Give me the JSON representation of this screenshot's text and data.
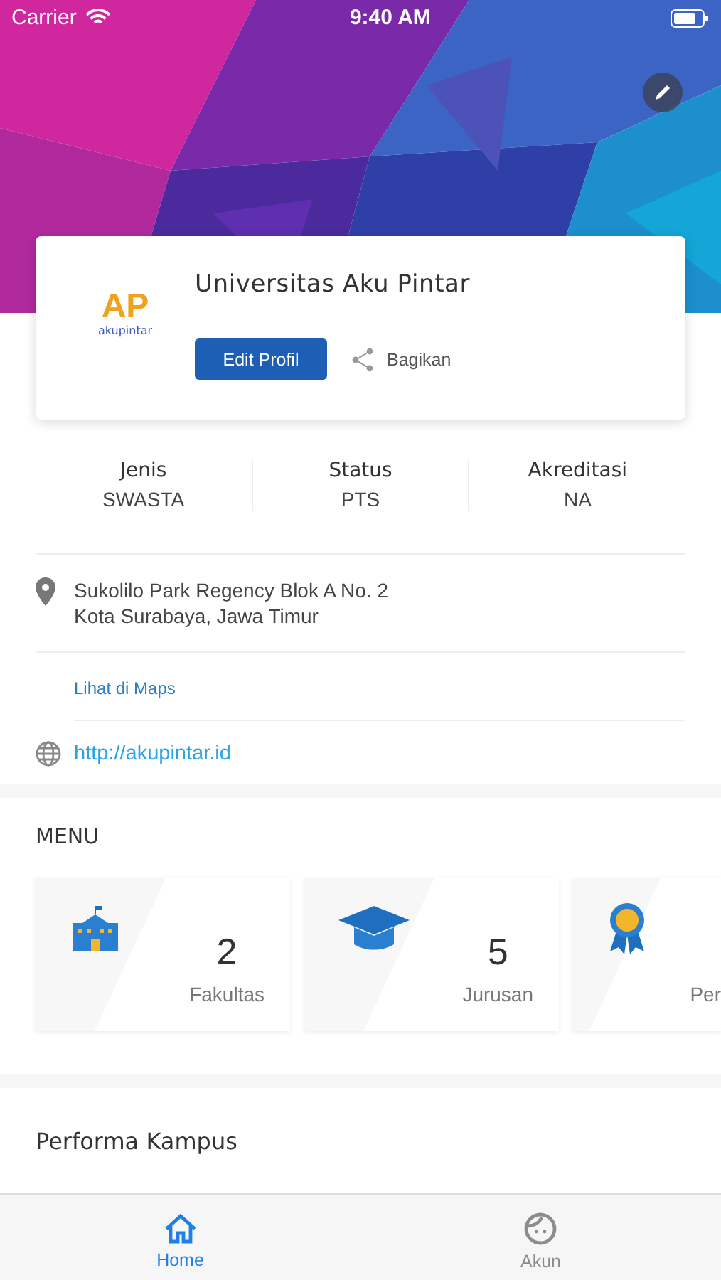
{
  "status_bar": {
    "carrier": "Carrier",
    "time": "9:40 AM"
  },
  "profile": {
    "logo_mark": "AP",
    "logo_word": "akupintar",
    "name": "Universitas Aku Pintar",
    "edit_button": "Edit Profil",
    "share_label": "Bagikan"
  },
  "info": [
    {
      "label": "Jenis",
      "value": "SWASTA"
    },
    {
      "label": "Status",
      "value": "PTS"
    },
    {
      "label": "Akreditasi",
      "value": "NA"
    }
  ],
  "address": {
    "line_1": "Sukolilo Park Regency Blok A No. 2",
    "line_2": "Kota Surabaya, Jawa Timur",
    "maps_link": "Lihat di Maps"
  },
  "website": "http://akupintar.id",
  "menu": {
    "title": "MENU",
    "items": [
      {
        "kind": "faculty",
        "count": "2",
        "label": "Fakultas"
      },
      {
        "kind": "major",
        "count": "5",
        "label": "Jurusan"
      },
      {
        "kind": "award",
        "label": "Per"
      }
    ]
  },
  "performance": {
    "title": "Performa Kampus"
  },
  "tab_bar": [
    {
      "kind": "home",
      "label": "Home",
      "selected": true
    },
    {
      "kind": "account",
      "label": "Akun",
      "selected": false
    }
  ]
}
